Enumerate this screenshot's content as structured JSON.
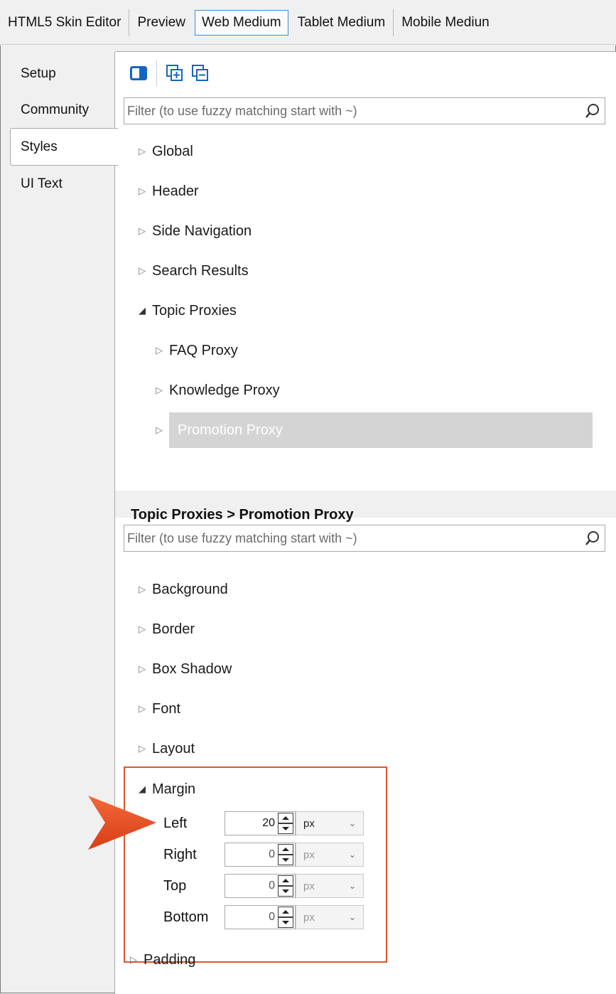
{
  "top_tabs": [
    "HTML5 Skin Editor",
    "Preview",
    "Web Medium",
    "Tablet Medium",
    "Mobile Mediun"
  ],
  "active_top_tab": "Web Medium",
  "left_tabs": [
    "Setup",
    "Community",
    "Styles",
    "UI Text"
  ],
  "active_left_tab": "Styles",
  "toolbar": {
    "icons": [
      "panel-toggle-icon",
      "expand-all-icon",
      "collapse-all-icon"
    ]
  },
  "filter_top": {
    "placeholder": "Filter (to use fuzzy matching start with ~)"
  },
  "style_tree": {
    "global": "Global",
    "header": "Header",
    "side_navigation": "Side Navigation",
    "search_results": "Search Results",
    "topic_proxies": "Topic Proxies",
    "faq_proxy": "FAQ Proxy",
    "knowledge_proxy": "Knowledge Proxy",
    "promotion_proxy": "Promotion Proxy"
  },
  "breadcrumb": "Topic Proxies > Promotion Proxy",
  "filter_bottom": {
    "placeholder": "Filter (to use fuzzy matching start with ~)"
  },
  "properties": {
    "background": "Background",
    "border": "Border",
    "box_shadow": "Box Shadow",
    "font": "Font",
    "layout": "Layout",
    "margin": "Margin",
    "padding": "Padding"
  },
  "margin_fields": [
    {
      "label": "Left",
      "value": "20",
      "unit": "px"
    },
    {
      "label": "Right",
      "value": "0",
      "unit": "px"
    },
    {
      "label": "Top",
      "value": "0",
      "unit": "px"
    },
    {
      "label": "Bottom",
      "value": "0",
      "unit": "px"
    }
  ],
  "colors": {
    "highlight_border": "#e2532d",
    "callout_arrow": "#e8481f",
    "active_tab_border": "#3c8dd6",
    "icon_blue": "#1565c0",
    "selected_row": "#d4d4d4"
  }
}
